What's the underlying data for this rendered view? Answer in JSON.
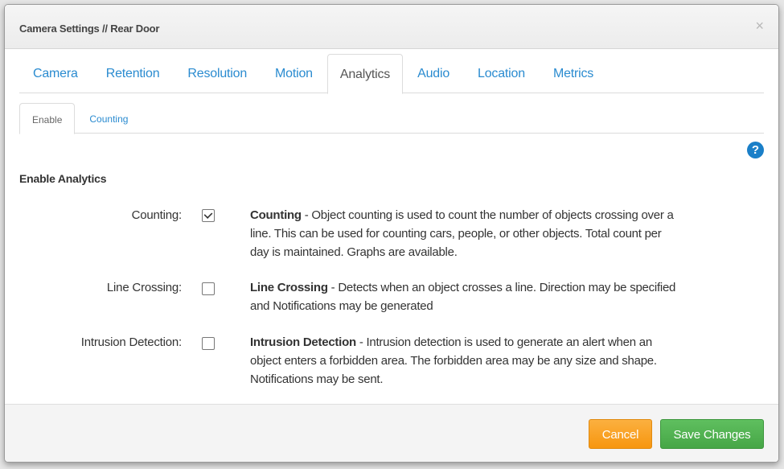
{
  "modal": {
    "title": "Camera Settings // Rear Door",
    "close_icon": "×"
  },
  "tabs": [
    {
      "label": "Camera",
      "active": false
    },
    {
      "label": "Retention",
      "active": false
    },
    {
      "label": "Resolution",
      "active": false
    },
    {
      "label": "Motion",
      "active": false
    },
    {
      "label": "Analytics",
      "active": true
    },
    {
      "label": "Audio",
      "active": false
    },
    {
      "label": "Location",
      "active": false
    },
    {
      "label": "Metrics",
      "active": false
    }
  ],
  "subtabs": [
    {
      "label": "Enable",
      "active": true
    },
    {
      "label": "Counting",
      "active": false
    }
  ],
  "help_icon": "?",
  "section_title": "Enable Analytics",
  "options": [
    {
      "label": "Counting:",
      "checked": true,
      "desc_title": "Counting",
      "desc_text": " - Object counting is used to count the number of objects crossing over a line. This can be used for counting cars, people, or other objects. Total count per day is maintained. Graphs are available."
    },
    {
      "label": "Line Crossing:",
      "checked": false,
      "desc_title": "Line Crossing",
      "desc_text": " - Detects when an object crosses a line. Direction may be specified and Notifications may be generated"
    },
    {
      "label": "Intrusion Detection:",
      "checked": false,
      "desc_title": "Intrusion Detection",
      "desc_text": " - Intrusion detection is used to generate an alert when an object enters a forbidden area. The forbidden area may be any size and shape. Notifications may be sent."
    }
  ],
  "footer": {
    "cancel_label": "Cancel",
    "save_label": "Save Changes"
  },
  "colors": {
    "link_blue": "#2a8bd0",
    "help_blue": "#1a7fc8",
    "cancel_orange": "#f7960f",
    "save_green": "#46a646"
  }
}
